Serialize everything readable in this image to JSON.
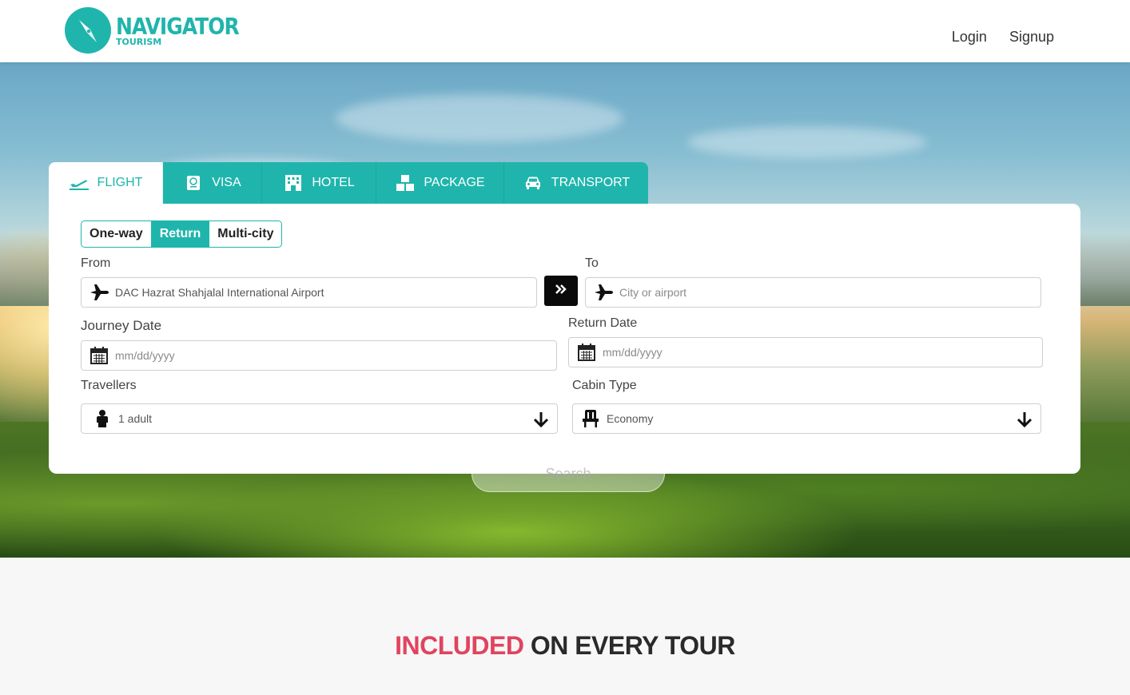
{
  "brand": {
    "title": "NAVIGATOR",
    "subtitle": "TOURISM",
    "color": "#1fb5ac"
  },
  "nav": {
    "login": "Login",
    "signup": "Signup"
  },
  "tabs": [
    {
      "label": "FLIGHT",
      "icon": "plane-departure-icon",
      "active": true
    },
    {
      "label": "VISA",
      "icon": "passport-icon",
      "active": false
    },
    {
      "label": "HOTEL",
      "icon": "hotel-icon",
      "active": false
    },
    {
      "label": "PACKAGE",
      "icon": "boxes-icon",
      "active": false
    },
    {
      "label": "TRANSPORT",
      "icon": "car-icon",
      "active": false
    }
  ],
  "trip_types": [
    {
      "label": "One-way",
      "active": false
    },
    {
      "label": "Return",
      "active": true
    },
    {
      "label": "Multi-city",
      "active": false
    }
  ],
  "form": {
    "from_label": "From",
    "from_value": "DAC Hazrat Shahjalal International Airport",
    "to_label": "To",
    "to_placeholder": "City or airport",
    "journey_label": "Journey Date",
    "journey_placeholder": "mm/dd/yyyy",
    "return_label": "Return Date",
    "return_placeholder": "mm/dd/yyyy",
    "travellers_label": "Travellers",
    "travellers_value": "1 adult",
    "cabin_label": "Cabin Type",
    "cabin_value": "Economy",
    "search_label": "Search"
  },
  "section": {
    "highlight": "INCLUDED",
    "rest": "ON EVERY TOUR",
    "highlight_color": "#e0445f"
  }
}
